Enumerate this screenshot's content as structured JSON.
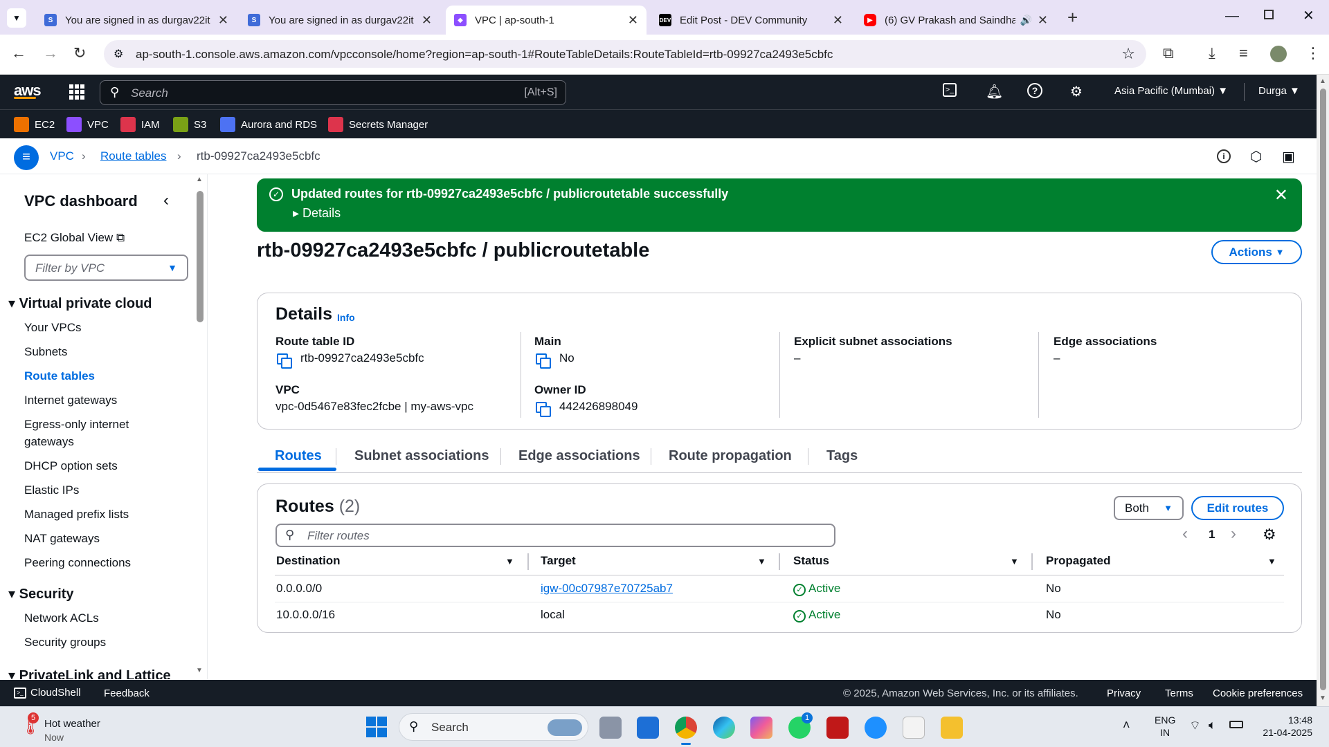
{
  "browser": {
    "tabs": [
      {
        "title": "You are signed in as durgav22it",
        "favicon": "S",
        "color": "#3f6bd8"
      },
      {
        "title": "You are signed in as durgav22it",
        "favicon": "S",
        "color": "#3f6bd8"
      },
      {
        "title": "VPC | ap-south-1",
        "favicon": "vpc",
        "color": "#8c4fff"
      },
      {
        "title": "Edit Post - DEV Community",
        "favicon": "DEV",
        "color": "#000000"
      },
      {
        "title": "(6) GV Prakash and Saindha",
        "favicon": "yt",
        "color": "#ff0000"
      }
    ],
    "url": "ap-south-1.console.aws.amazon.com/vpcconsole/home?region=ap-south-1#RouteTableDetails:RouteTableId=rtb-09927ca2493e5cbfc"
  },
  "aws": {
    "logo": "aws",
    "search_placeholder": "Search",
    "search_shortcut": "[Alt+S]",
    "region": "Asia Pacific (Mumbai)",
    "user": "Durga",
    "favorites": [
      "EC2",
      "VPC",
      "IAM",
      "S3",
      "Aurora and RDS",
      "Secrets Manager"
    ],
    "favorite_colors": [
      "#ed7100",
      "#8c4fff",
      "#dd344c",
      "#7aa116",
      "#4d72f3",
      "#dd344c"
    ]
  },
  "breadcrumb": {
    "items": [
      "VPC",
      "Route tables"
    ],
    "current": "rtb-09927ca2493e5cbfc"
  },
  "sidebar": {
    "title": "VPC dashboard",
    "global_view": "EC2 Global View",
    "filter_placeholder": "Filter by VPC",
    "section_vpc": "Virtual private cloud",
    "vpc_items": [
      "Your VPCs",
      "Subnets",
      "Route tables",
      "Internet gateways",
      "Egress-only internet",
      "gateways",
      "DHCP option sets",
      "Elastic IPs",
      "Managed prefix lists",
      "NAT gateways",
      "Peering connections"
    ],
    "section_security": "Security",
    "security_items": [
      "Network ACLs",
      "Security groups"
    ],
    "section_privatelink": "PrivateLink and Lattice"
  },
  "flash": {
    "message": "Updated routes for rtb-09927ca2493e5cbfc / publicroutetable successfully",
    "details": "Details"
  },
  "page": {
    "title": "rtb-09927ca2493e5cbfc / publicroutetable",
    "actions": "Actions"
  },
  "details": {
    "header": "Details",
    "info": "Info",
    "route_table_id_label": "Route table ID",
    "route_table_id": "rtb-09927ca2493e5cbfc",
    "main_label": "Main",
    "main": "No",
    "explicit_label": "Explicit subnet associations",
    "explicit": "–",
    "edge_label": "Edge associations",
    "edge": "–",
    "vpc_label": "VPC",
    "vpc": "vpc-0d5467e83fec2fcbe | my-aws-vpc",
    "owner_label": "Owner ID",
    "owner": "442426898049"
  },
  "tabs": [
    "Routes",
    "Subnet associations",
    "Edge associations",
    "Route propagation",
    "Tags"
  ],
  "routes": {
    "title": "Routes",
    "count": "(2)",
    "filter_value": "Both",
    "edit": "Edit routes",
    "filter_placeholder": "Filter routes",
    "page": "1",
    "columns": [
      "Destination",
      "Target",
      "Status",
      "Propagated"
    ],
    "rows": [
      {
        "destination": "0.0.0.0/0",
        "target": "igw-00c07987e70725ab7",
        "status": "Active",
        "propagated": "No"
      },
      {
        "destination": "10.0.0.0/16",
        "target": "local",
        "status": "Active",
        "propagated": "No"
      }
    ]
  },
  "footer": {
    "cloudshell": "CloudShell",
    "feedback": "Feedback",
    "copyright": "© 2025, Amazon Web Services, Inc. or its affiliates.",
    "privacy": "Privacy",
    "terms": "Terms",
    "cookies": "Cookie preferences"
  },
  "taskbar": {
    "weather_title": "Hot weather",
    "weather_sub": "Now",
    "search": "Search",
    "lang1": "ENG",
    "lang2": "IN",
    "time": "13:48",
    "date": "21-04-2025",
    "badge": "5",
    "wa_badge": "1"
  }
}
